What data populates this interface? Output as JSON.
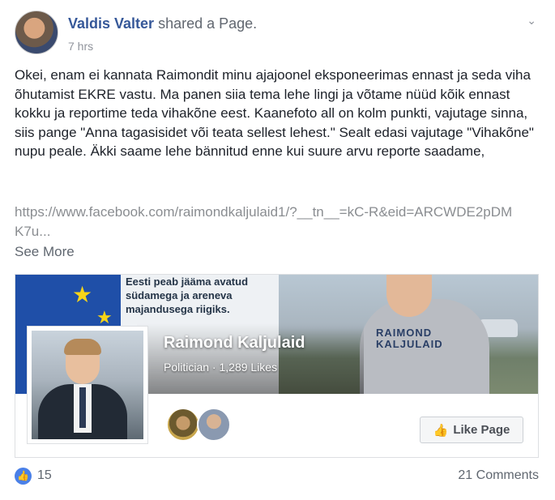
{
  "post": {
    "author": "Valdis Valter",
    "action": "shared a Page.",
    "time": "7 hrs",
    "text": "Okei, enam ei kannata Raimondit minu ajajoonel eksponeerimas ennast ja seda viha õhutamist EKRE vastu. Ma panen siia tema lehe lingi ja võtame nüüd kõik ennast kokku ja reportime teda vihakõne eest. Kaanefoto all on kolm punkti, vajutage sinna, siis pange \"Anna tagasisidet või teata sellest lehest.\" Sealt edasi vajutage \"Vihakõne\" nupu peale. Äkki saame lehe bännitud enne kui suure arvu reporte saadame,",
    "link": "https://www.facebook.com/raimondkaljulaid1/?__tn__=kC-R&eid=ARCWDE2pDMK7u...",
    "see_more": "See More"
  },
  "card": {
    "cover_slogan": "Eesti peab jääma avatud südamega ja areneva majandusega riigiks.",
    "cover_shirt_text": "RAIMOND KALJULAID",
    "page_name": "Raimond Kaljulaid",
    "category": "Politician",
    "likes": "1,289 Likes",
    "like_button": "Like Page"
  },
  "footer": {
    "reaction_count": "15",
    "comments": "21 Comments"
  },
  "icons": {
    "menu": "chevron-down-icon",
    "reaction": "like-thumb-icon",
    "like_page": "thumbs-up-icon"
  },
  "colors": {
    "link": "#365899",
    "like_blue": "#4a80e8",
    "eu_blue": "#1f4fa8"
  }
}
